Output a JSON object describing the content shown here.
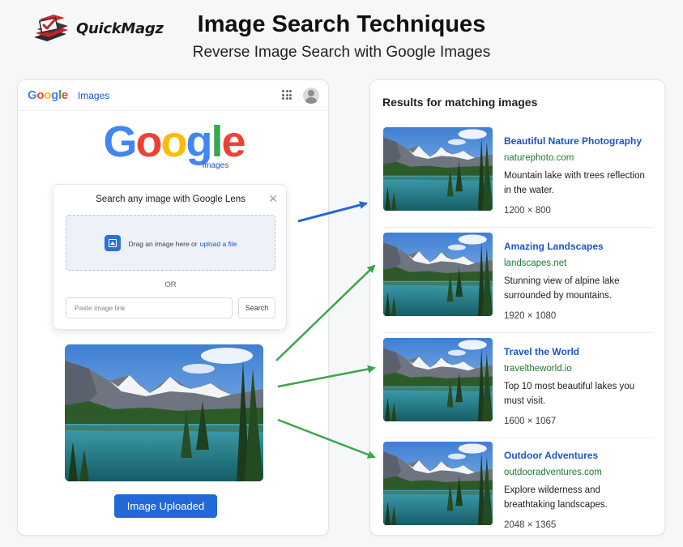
{
  "brand": {
    "name": "QuickMagz"
  },
  "header": {
    "title": "Image Search Techniques",
    "subtitle": "Reverse Image Search with Google Images"
  },
  "search_page": {
    "topbar": {
      "logo_text": "Google",
      "images_link": "Images",
      "apps_icon": "apps-grid-icon",
      "account_icon": "account-icon"
    },
    "logo": {
      "text": "Google",
      "sub": "images"
    },
    "lens_dialog": {
      "title": "Search any image with Google Lens",
      "drop_text": "Drag an image here or",
      "drop_link": "upload a file",
      "divider": "OR",
      "link_placeholder": "Paste image link",
      "search_label": "Search"
    },
    "upload_button": "Image Uploaded"
  },
  "results": {
    "heading": "Results for matching images",
    "items": [
      {
        "title": "Beautiful Nature Photography",
        "site": "naturephoto.com",
        "description": "Mountain lake with trees reflection in the water.",
        "dimensions": "1200 × 800"
      },
      {
        "title": "Amazing Landscapes",
        "site": "landscapes.net",
        "description": "Stunning view of alpine lake surrounded by mountains.",
        "dimensions": "1920 × 1080"
      },
      {
        "title": "Travel the World",
        "site": "traveltheworld.io",
        "description": "Top 10 most beautiful lakes you must visit.",
        "dimensions": "1600 × 1067"
      },
      {
        "title": "Outdoor Adventures",
        "site": "outdooradventures.com",
        "description": "Explore wilderness and breathtaking landscapes.",
        "dimensions": "2048 × 1365"
      }
    ]
  },
  "colors": {
    "google_blue": "#4285F4",
    "google_red": "#EA4335",
    "google_yellow": "#FBBC05",
    "google_green": "#34A853",
    "link_blue": "#1a56c4",
    "url_green": "#1e7a34",
    "arrow_blue": "#2a66d0",
    "arrow_green": "#3aa64a"
  }
}
